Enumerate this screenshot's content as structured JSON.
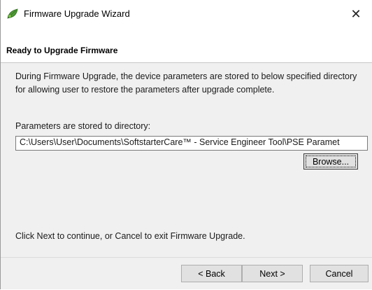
{
  "window": {
    "title": "Firmware Upgrade Wizard",
    "close_glyph": "✕",
    "app_icon": "leaf-gear-icon"
  },
  "header": {
    "title": "Ready to Upgrade Firmware"
  },
  "content": {
    "description": "During Firmware Upgrade, the device parameters are stored to below specified directory for allowing user to restore the parameters after upgrade complete.",
    "directory_label": "Parameters are stored to directory:",
    "directory_value": "C:\\Users\\User\\Documents\\SoftstarterCare™ - Service Engineer Tool\\PSE Paramet",
    "browse_label": "Browse...",
    "hint": "Click Next to continue, or Cancel to exit Firmware Upgrade."
  },
  "footer": {
    "back_label": "< Back",
    "next_label": "Next >",
    "cancel_label": "Cancel"
  },
  "colors": {
    "panel_bg": "#f0f0f0",
    "button_bg": "#e1e1e1",
    "icon_green": "#3a8a2e"
  }
}
